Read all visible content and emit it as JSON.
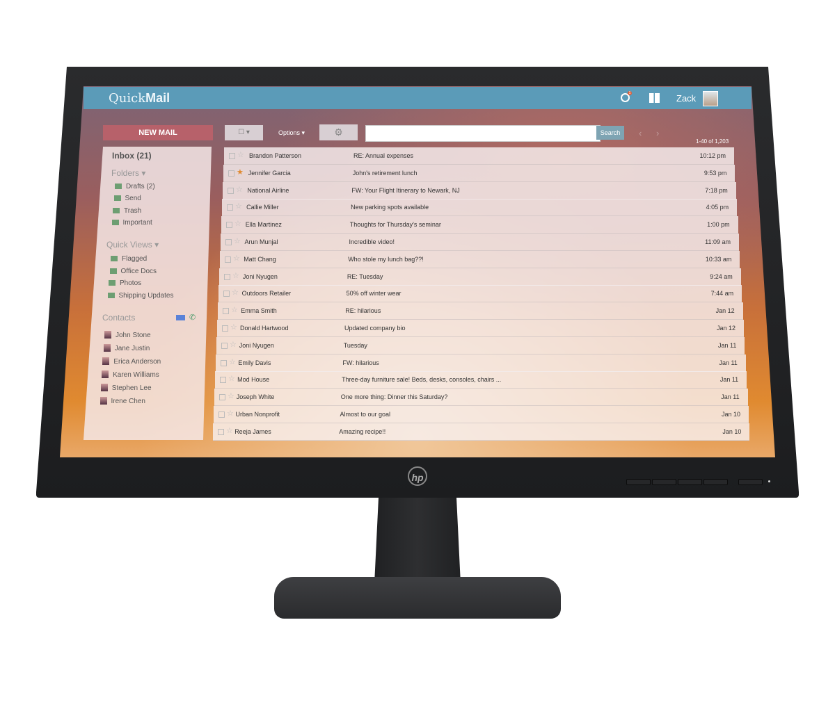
{
  "app": {
    "logo_light": "Quick",
    "logo_bold": "Mail",
    "user": "Zack",
    "notification_count": "1"
  },
  "toolbar": {
    "new_mail": "NEW MAIL",
    "options": "Options ▾",
    "search_placeholder": "",
    "search_button": "Search",
    "pager": "1-40 of 1,203"
  },
  "sidebar": {
    "inbox": "Inbox (21)",
    "folders_header": "Folders ▾",
    "folders": [
      "Drafts (2)",
      "Send",
      "Trash",
      "Important"
    ],
    "quick_views_header": "Quick Views ▾",
    "quick_views": [
      "Flagged",
      "Office Docs",
      "Photos",
      "Shipping Updates"
    ],
    "contacts_header": "Contacts",
    "contacts": [
      "John Stone",
      "Jane Justin",
      "Erica Anderson",
      "Karen Williams",
      "Stephen Lee",
      "Irene Chen"
    ]
  },
  "emails": [
    {
      "from": "Brandon Patterson",
      "subject": "RE: Annual expenses",
      "time": "10:12 pm",
      "starred": false
    },
    {
      "from": "Jennifer Garcia",
      "subject": "John's retirement lunch",
      "time": "9:53 pm",
      "starred": true
    },
    {
      "from": "National Airline",
      "subject": "FW: Your Flight Itinerary to Newark, NJ",
      "time": "7:18 pm",
      "starred": false
    },
    {
      "from": "Callie Miller",
      "subject": "New parking spots available",
      "time": "4:05 pm",
      "starred": false
    },
    {
      "from": "Ella Martinez",
      "subject": "Thoughts for Thursday's seminar",
      "time": "1:00 pm",
      "starred": false
    },
    {
      "from": "Arun Munjal",
      "subject": "Incredible video!",
      "time": "11:09 am",
      "starred": false
    },
    {
      "from": "Matt Chang",
      "subject": "Who stole my lunch bag??!",
      "time": "10:33 am",
      "starred": false
    },
    {
      "from": "Joni Nyugen",
      "subject": "RE: Tuesday",
      "time": "9:24 am",
      "starred": false
    },
    {
      "from": "Outdoors Retailer",
      "subject": "50% off winter wear",
      "time": "7:44 am",
      "starred": false
    },
    {
      "from": "Emma Smith",
      "subject": "RE: hilarious",
      "time": "Jan 12",
      "starred": false
    },
    {
      "from": "Donald Hartwood",
      "subject": "Updated company bio",
      "time": "Jan 12",
      "starred": false
    },
    {
      "from": "Joni Nyugen",
      "subject": "Tuesday",
      "time": "Jan 11",
      "starred": false
    },
    {
      "from": "Emily Davis",
      "subject": "FW: hilarious",
      "time": "Jan 11",
      "starred": false
    },
    {
      "from": "Mod House",
      "subject": "Three-day furniture sale! Beds, desks, consoles, chairs ...",
      "time": "Jan 11",
      "starred": false
    },
    {
      "from": "Joseph White",
      "subject": "One more thing: Dinner this Saturday?",
      "time": "Jan 11",
      "starred": false
    },
    {
      "from": "Urban Nonprofit",
      "subject": "Almost to our goal",
      "time": "Jan 10",
      "starred": false
    },
    {
      "from": "Reeja James",
      "subject": "Amazing recipe!!",
      "time": "Jan 10",
      "starred": false
    }
  ],
  "monitor": {
    "brand_logo": "hp"
  },
  "colors": {
    "topbar": "#5b9bb8",
    "new_mail": "#b7616a",
    "folder_icon": "#6d9e72",
    "star_on": "#e08a30"
  }
}
